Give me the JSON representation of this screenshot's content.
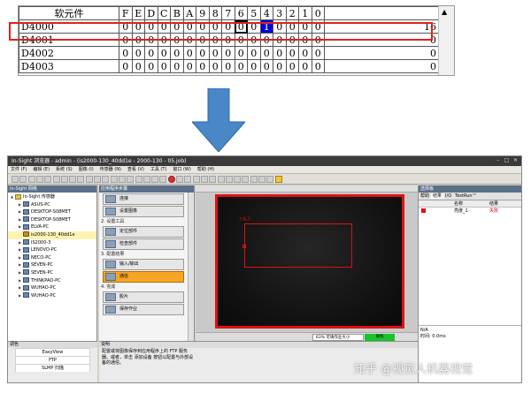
{
  "register_table": {
    "header_label": "软元件",
    "bit_headers": [
      "F",
      "E",
      "D",
      "C",
      "B",
      "A",
      "9",
      "8",
      "7",
      "6",
      "5",
      "4",
      "3",
      "2",
      "1",
      "0"
    ],
    "rows": [
      {
        "name": "D4000",
        "bits": [
          "0",
          "0",
          "0",
          "0",
          "0",
          "0",
          "0",
          "0",
          "0",
          "0",
          "0",
          "1",
          "0",
          "0",
          "0",
          "0"
        ],
        "value": "16"
      },
      {
        "name": "D4001",
        "bits": [
          "0",
          "0",
          "0",
          "0",
          "0",
          "0",
          "0",
          "0",
          "0",
          "0",
          "0",
          "0",
          "0",
          "0",
          "0",
          "0"
        ],
        "value": "0"
      },
      {
        "name": "D4002",
        "bits": [
          "0",
          "0",
          "0",
          "0",
          "0",
          "0",
          "0",
          "0",
          "0",
          "0",
          "0",
          "0",
          "0",
          "0",
          "0",
          "0"
        ],
        "value": "0"
      },
      {
        "name": "D4003",
        "bits": [
          "0",
          "0",
          "0",
          "0",
          "0",
          "0",
          "0",
          "0",
          "0",
          "0",
          "0",
          "0",
          "0",
          "0",
          "0",
          "0"
        ],
        "value": "0"
      }
    ],
    "scroll_up_icon": "triangle-up-icon"
  },
  "arrow": {
    "color": "#4a87c6"
  },
  "window": {
    "title": "In-Sight 浏览器 - admin - (is2000-130_40dd1e - 2000-130 - 05.job)",
    "menu": [
      "文件 (F)",
      "编辑 (E)",
      "系统 (S)",
      "图像 (I)",
      "传感器 (N)",
      "查看 (V)",
      "工具 (T)",
      "窗口 (W)",
      "帮助 (H)"
    ],
    "left_panel_title": "In-Sight 网络",
    "tree": [
      {
        "label": "In-Sight 传感器",
        "level": 0,
        "kind": "root"
      },
      {
        "label": "ASUS-PC",
        "level": 1
      },
      {
        "label": "DESKTOP-S08MET",
        "level": 1
      },
      {
        "label": "DESKTOP-S08MET",
        "level": 1
      },
      {
        "label": "ELVA-PC",
        "level": 1
      },
      {
        "label": "is2000-130_40dd1e",
        "level": 1,
        "kind": "sensor",
        "selected": true
      },
      {
        "label": "IS2000-3",
        "level": 1
      },
      {
        "label": "LENOVO-PC",
        "level": 1
      },
      {
        "label": "NECO-PC",
        "level": 1
      },
      {
        "label": "SEVEN-PC",
        "level": 1
      },
      {
        "label": "SEVEN-PC",
        "level": 1
      },
      {
        "label": "THINKPAD-PC",
        "level": 1
      },
      {
        "label": "WUHAO-PC",
        "level": 1
      },
      {
        "label": "WUHAO-PC",
        "level": 1
      }
    ],
    "left_bottom": {
      "title": "调色",
      "items": [
        "EasyView",
        "FTP",
        "SLMP 扫描"
      ]
    },
    "steps_title": "应用程序步骤",
    "steps": [
      {
        "type": "btn",
        "label": "连接"
      },
      {
        "type": "btn",
        "label": "设置图像"
      },
      {
        "type": "sec",
        "label": "2. 设置工具"
      },
      {
        "type": "btn",
        "label": "定位部件"
      },
      {
        "type": "btn",
        "label": "检查部件"
      },
      {
        "type": "sec",
        "label": "3. 配置结果"
      },
      {
        "type": "btn",
        "label": "输入/输出"
      },
      {
        "type": "btn",
        "label": "通信",
        "active": true
      },
      {
        "type": "sec",
        "label": "4. 完成"
      },
      {
        "type": "btn",
        "label": "胶片"
      },
      {
        "type": "btn",
        "label": "保存作业"
      }
    ],
    "help_title": "说明",
    "help_text": "配置或将图像保存到应用程序上的 FTP 服务器。或者，单击 添加设备 按钮以配置与外部设备的通信。",
    "view": {
      "roi_label": "工具_1",
      "zoom_text": "63% 可填作业大小",
      "status_text": "联机",
      "status_color": "#18c32b",
      "frame_color": "#e01111"
    },
    "right_panel": {
      "title": "选择板",
      "tabs": [
        "帮助",
        "结果",
        "I/O",
        "TestRun™"
      ],
      "active_tab": "结果",
      "columns": [
        "",
        "名称",
        "结果"
      ],
      "rows": [
        {
          "name": "亮度_1",
          "result": "失败"
        }
      ],
      "no_result_label": "N/A",
      "time_label": "时间: 0.0ms"
    }
  },
  "watermark": "知乎 @视觉人机器视觉"
}
